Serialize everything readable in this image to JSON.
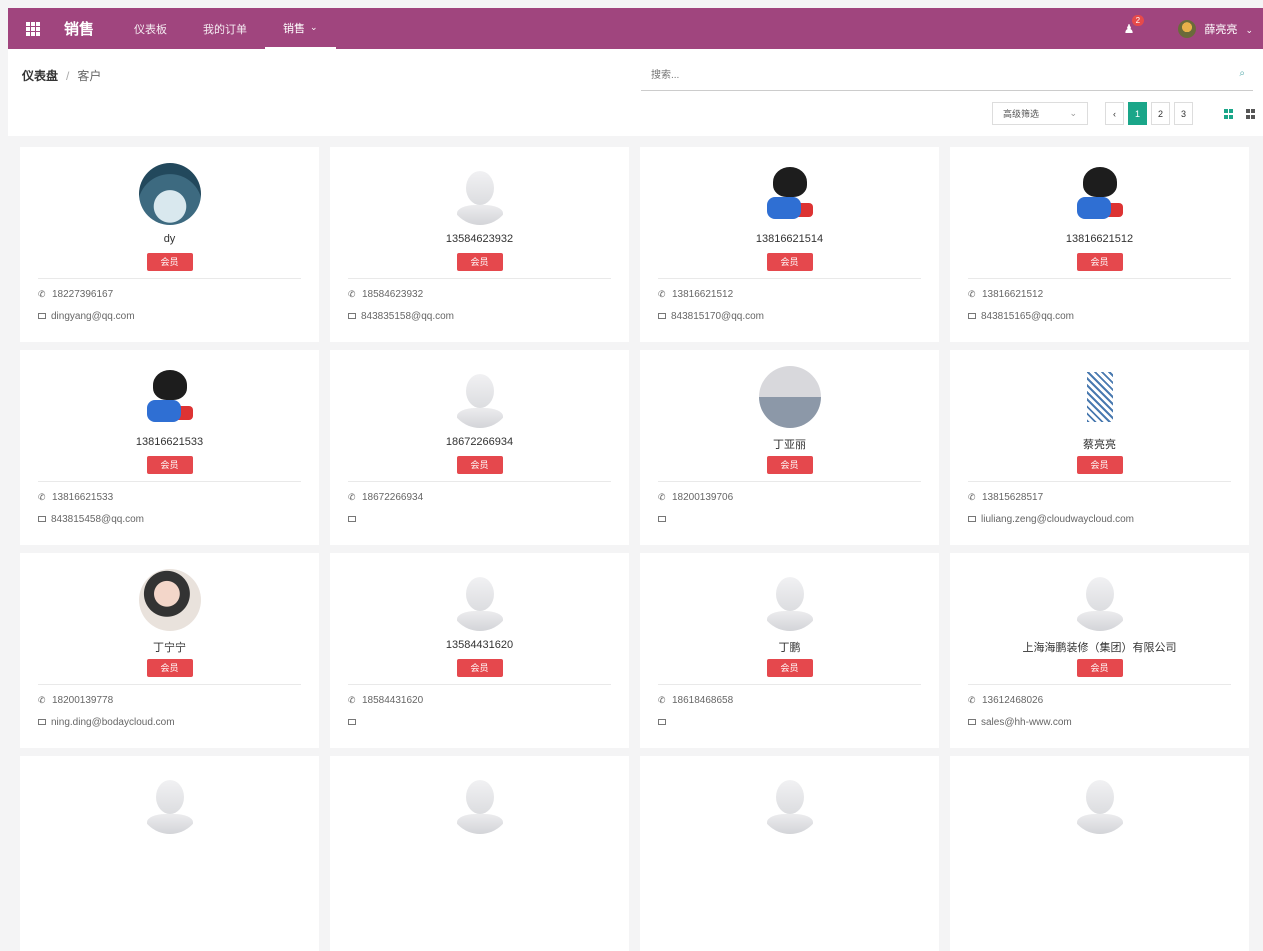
{
  "navbar": {
    "brand": "销售",
    "menu": [
      {
        "label": "仪表板",
        "active": false
      },
      {
        "label": "我的订单",
        "active": false
      },
      {
        "label": "销售",
        "active": true
      }
    ],
    "notification_count": "2",
    "user_name": "薛亮亮",
    "accent_color": "#a0457e"
  },
  "breadcrumb": {
    "root": "仪表盘",
    "separator": "/",
    "current": "客户"
  },
  "search": {
    "placeholder": "搜索..."
  },
  "filter": {
    "label": "高级筛选"
  },
  "pager": {
    "prev": "‹",
    "pages": [
      "1",
      "2",
      "3"
    ],
    "active_page": "1"
  },
  "cards": [
    {
      "name": "dy",
      "avatar": "photo1",
      "tag": "会员",
      "phone": "18227396167",
      "email": "dingyang@qq.com"
    },
    {
      "name": "13584623932",
      "avatar": "default",
      "tag": "会员",
      "phone": "18584623932",
      "email": "843835158@qq.com"
    },
    {
      "name": "13816621514",
      "avatar": "cartoon",
      "tag": "会员",
      "phone": "13816621512",
      "email": "843815170@qq.com"
    },
    {
      "name": "13816621512",
      "avatar": "cartoon",
      "tag": "会员",
      "phone": "13816621512",
      "email": "843815165@qq.com"
    },
    {
      "name": "13816621533",
      "avatar": "cartoon",
      "tag": "会员",
      "phone": "13816621533",
      "email": "843815458@qq.com"
    },
    {
      "name": "18672266934",
      "avatar": "default",
      "tag": "会员",
      "phone": "18672266934",
      "email": ""
    },
    {
      "name": "丁亚丽",
      "avatar": "photo2",
      "tag": "会员",
      "phone": "18200139706",
      "email": ""
    },
    {
      "name": "蔡亮亮",
      "avatar": "sketch",
      "tag": "会员",
      "phone": "13815628517",
      "email": "liuliang.zeng@cloudwaycloud.com"
    },
    {
      "name": "丁宁宁",
      "avatar": "photo3",
      "tag": "会员",
      "phone": "18200139778",
      "email": "ning.ding@bodaycloud.com"
    },
    {
      "name": "13584431620",
      "avatar": "default",
      "tag": "会员",
      "phone": "18584431620",
      "email": ""
    },
    {
      "name": "丁鹏",
      "avatar": "default",
      "tag": "会员",
      "phone": "18618468658",
      "email": ""
    },
    {
      "name": "上海海鹏装修（集团）有限公司",
      "avatar": "default",
      "tag": "会员",
      "phone": "13612468026",
      "email": "sales@hh-www.com"
    }
  ]
}
